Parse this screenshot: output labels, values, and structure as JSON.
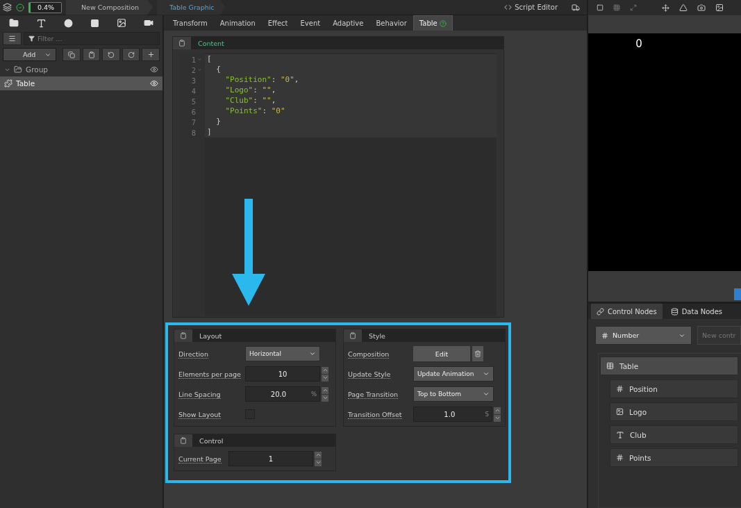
{
  "topbar": {
    "progress": "0.4%",
    "breadcrumbs": [
      {
        "label": "New Composition",
        "selected": false
      },
      {
        "label": "Table Graphic",
        "selected": true
      }
    ],
    "script_editor": "Script Editor"
  },
  "toolbox": {
    "filter_placeholder": "Filter ...",
    "add_label": "Add"
  },
  "tree": [
    {
      "label": "Group",
      "kind": "group",
      "selected": false
    },
    {
      "label": "Table",
      "kind": "table",
      "selected": true
    }
  ],
  "tabs": [
    {
      "label": "Transform",
      "selected": false
    },
    {
      "label": "Animation",
      "selected": false
    },
    {
      "label": "Effect",
      "selected": false
    },
    {
      "label": "Event",
      "selected": false
    },
    {
      "label": "Adaptive",
      "selected": false
    },
    {
      "label": "Behavior",
      "selected": false
    },
    {
      "label": "Table",
      "selected": true
    }
  ],
  "content": {
    "title": "Content",
    "lines": [
      {
        "number": "1",
        "fold": true,
        "tokens": [
          {
            "kind": "punct",
            "text": "["
          }
        ]
      },
      {
        "number": "2",
        "fold": true,
        "tokens": [
          {
            "kind": "punct",
            "text": "  {"
          }
        ]
      },
      {
        "number": "3",
        "fold": false,
        "tokens": [
          {
            "kind": "key",
            "text": "    \"Position\""
          },
          {
            "kind": "punct",
            "text": ": "
          },
          {
            "kind": "string",
            "text": "\"0\""
          },
          {
            "kind": "punct",
            "text": ","
          }
        ]
      },
      {
        "number": "4",
        "fold": false,
        "tokens": [
          {
            "kind": "key",
            "text": "    \"Logo\""
          },
          {
            "kind": "punct",
            "text": ": "
          },
          {
            "kind": "string",
            "text": "\"\""
          },
          {
            "kind": "punct",
            "text": ","
          }
        ]
      },
      {
        "number": "5",
        "fold": false,
        "tokens": [
          {
            "kind": "key",
            "text": "    \"Club\""
          },
          {
            "kind": "punct",
            "text": ": "
          },
          {
            "kind": "string",
            "text": "\"\""
          },
          {
            "kind": "punct",
            "text": ","
          }
        ]
      },
      {
        "number": "6",
        "fold": false,
        "tokens": [
          {
            "kind": "key",
            "text": "    \"Points\""
          },
          {
            "kind": "punct",
            "text": ": "
          },
          {
            "kind": "string",
            "text": "\"0\""
          }
        ]
      },
      {
        "number": "7",
        "fold": false,
        "tokens": [
          {
            "kind": "punct",
            "text": "  }"
          }
        ]
      },
      {
        "number": "8",
        "fold": false,
        "tokens": [
          {
            "kind": "punct",
            "text": "]"
          }
        ]
      }
    ]
  },
  "layout_panel": {
    "title": "Layout",
    "rows": [
      {
        "kind": "select",
        "label": "Direction",
        "value": "Horizontal"
      },
      {
        "kind": "number",
        "label": "Elements per page",
        "value": "10"
      },
      {
        "kind": "number",
        "label": "Line Spacing",
        "value": "20.0",
        "unit": "%"
      },
      {
        "kind": "checkbox",
        "label": "Show Layout",
        "checked": false
      }
    ]
  },
  "style_panel": {
    "title": "Style",
    "rows": [
      {
        "kind": "button",
        "label": "Composition",
        "value": "Edit"
      },
      {
        "kind": "select",
        "label": "Update Style",
        "value": "Update Animation"
      },
      {
        "kind": "select",
        "label": "Page Transition",
        "value": "Top to Bottom"
      },
      {
        "kind": "number",
        "label": "Transition Offset",
        "value": "1.0",
        "unit": "S"
      }
    ]
  },
  "control_panel": {
    "title": "Control",
    "rows": [
      {
        "kind": "number",
        "label": "Current Page",
        "value": "1"
      }
    ]
  },
  "preview": {
    "text": "0"
  },
  "node_tabs": [
    {
      "label": "Control Nodes",
      "selected": true
    },
    {
      "label": "Data Nodes",
      "selected": false
    }
  ],
  "node_type": "Number",
  "new_control_placeholder": "New contr",
  "nodes": [
    {
      "label": "Table",
      "kind": "table",
      "children": [
        {
          "label": "Position",
          "kind": "number"
        },
        {
          "label": "Logo",
          "kind": "image"
        },
        {
          "label": "Club",
          "kind": "text"
        },
        {
          "label": "Points",
          "kind": "number"
        }
      ]
    }
  ]
}
